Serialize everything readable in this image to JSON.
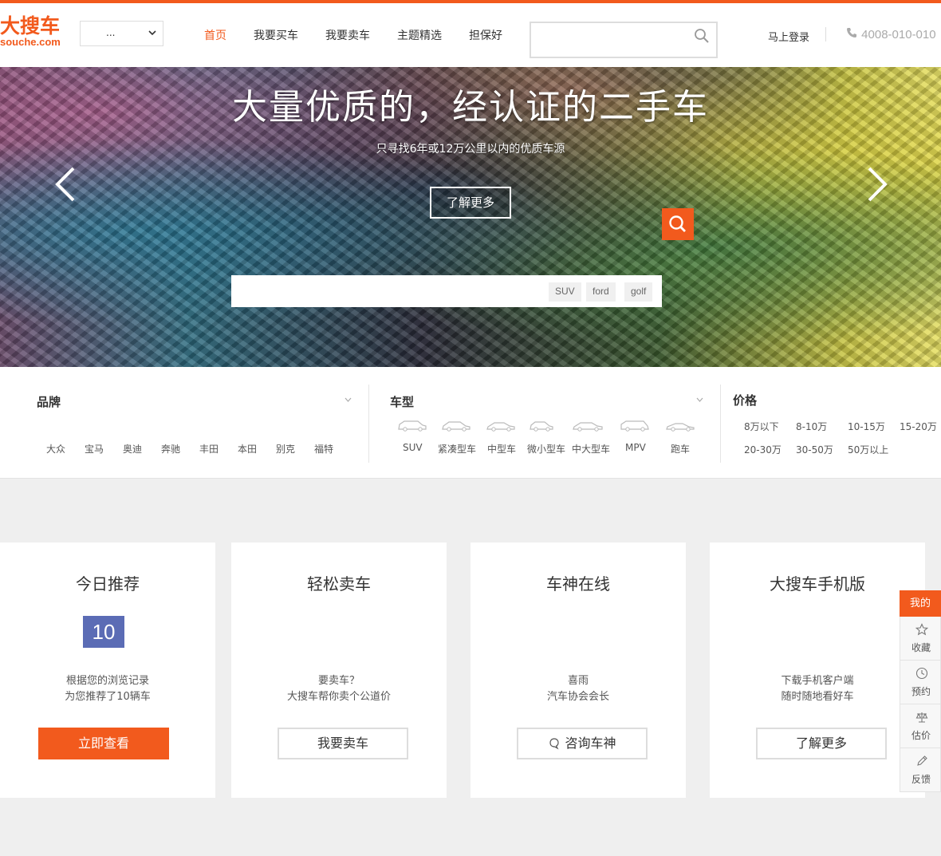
{
  "header": {
    "logo_cn": "大搜车",
    "logo_en": "souche.com",
    "city_select": "...",
    "nav": [
      {
        "label": "首页",
        "active": true
      },
      {
        "label": "我要买车",
        "active": false
      },
      {
        "label": "我要卖车",
        "active": false
      },
      {
        "label": "主题精选",
        "active": false
      },
      {
        "label": "担保好",
        "active": false
      }
    ],
    "search_placeholder": "",
    "login": "马上登录",
    "phone": "4008-010-010"
  },
  "hero": {
    "title": "大量优质的，经认证的二手车",
    "subtitle": "只寻找6年或12万公里以内的优质车源",
    "cta": "了解更多",
    "search_tags": [
      "SUV",
      "ford",
      "golf"
    ]
  },
  "filters": {
    "brand": {
      "title": "品牌",
      "items": [
        "大众",
        "宝马",
        "奥迪",
        "奔驰",
        "丰田",
        "本田",
        "别克",
        "福特"
      ]
    },
    "type": {
      "title": "车型",
      "items": [
        "SUV",
        "紧凑型车",
        "中型车",
        "微小型车",
        "中大型车",
        "MPV",
        "跑车"
      ]
    },
    "price": {
      "title": "价格",
      "items": [
        "8万以下",
        "8-10万",
        "10-15万",
        "15-20万",
        "20-30万",
        "30-50万",
        "50万以上"
      ]
    }
  },
  "cards": [
    {
      "title": "今日推荐",
      "badge": "10",
      "desc1": "根据您的浏览记录",
      "desc2": "为您推荐了10辆车",
      "button": "立即查看"
    },
    {
      "title": "轻松卖车",
      "desc1": "要卖车？",
      "desc2": "大搜车帮你卖个公道价",
      "button": "我要卖车"
    },
    {
      "title": "车神在线",
      "desc1": "喜雨",
      "desc2": "汽车协会会长",
      "button": "咨询车神"
    },
    {
      "title": "大搜车手机版",
      "desc1": "下载手机客户端",
      "desc2": "随时随地看好车",
      "button": "了解更多"
    }
  ],
  "sidebar": {
    "top": "我的",
    "items": [
      "收藏",
      "预约",
      "估价",
      "反馈"
    ]
  },
  "colors": {
    "brand": "#f25a1d",
    "badge": "#5b6cb5"
  }
}
